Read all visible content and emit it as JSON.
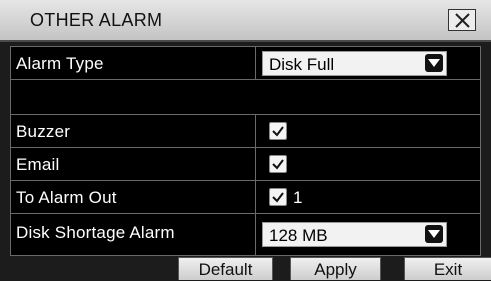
{
  "window": {
    "title": "OTHER ALARM",
    "close_icon": "close-x"
  },
  "rows": {
    "alarm_type": {
      "label": "Alarm Type",
      "value": "Disk Full"
    },
    "buzzer": {
      "label": "Buzzer",
      "checked": true
    },
    "email": {
      "label": "Email",
      "checked": true
    },
    "to_alarm_out": {
      "label": "To Alarm Out",
      "checked": true,
      "channel": "1"
    },
    "disk_shortage": {
      "label": "Disk Shortage Alarm",
      "value": "128 MB"
    }
  },
  "buttons": {
    "default": "Default",
    "apply": "Apply",
    "exit": "Exit"
  },
  "colors": {
    "background": "#000000",
    "titlebar": "#d6d6d6",
    "text": "#ffffff"
  }
}
